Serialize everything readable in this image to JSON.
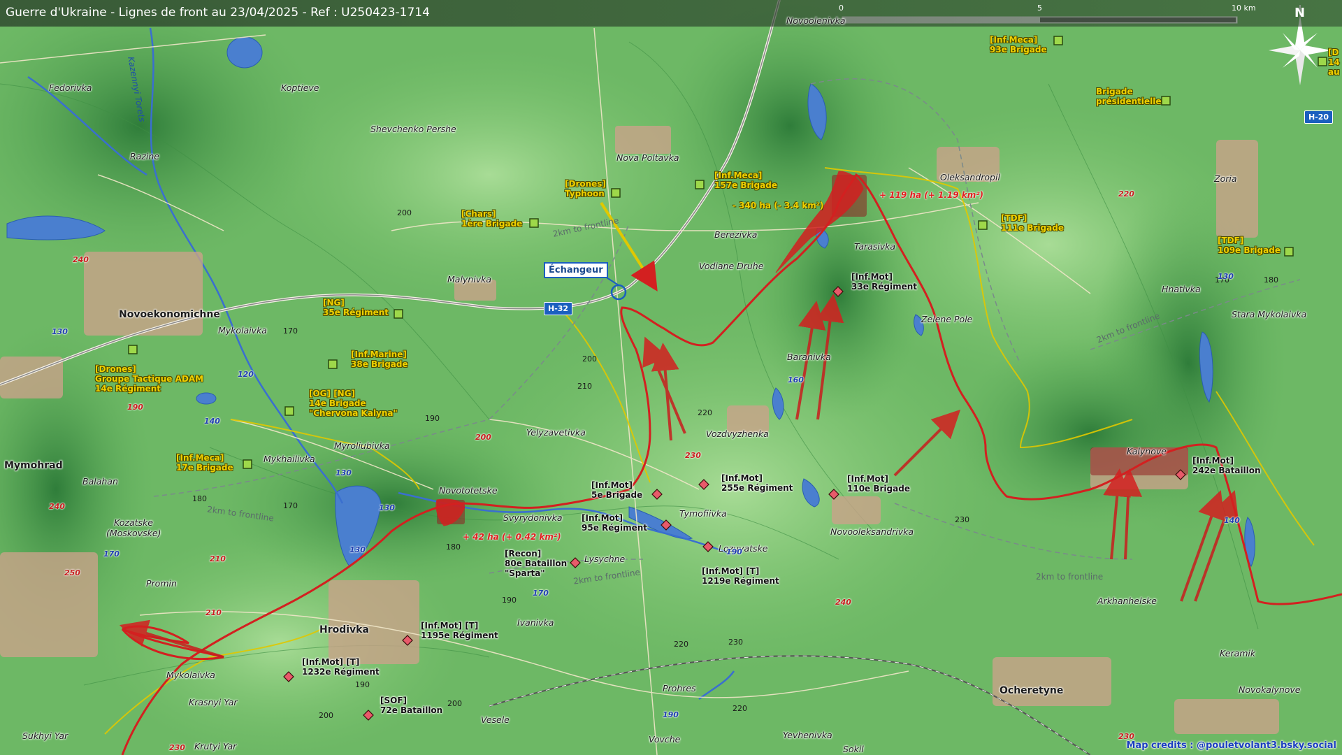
{
  "title": "Guerre d'Ukraine - Lignes de front au 23/04/2025 - Ref : U250423-1714",
  "scale": {
    "labels": [
      "0",
      "5",
      "10 km"
    ]
  },
  "north": "N",
  "colors": {
    "ukrainian_units": "#f0d000",
    "russian_units": "#e05060",
    "frontline": "#d32020",
    "water": "#4a7fcf",
    "road_shield": "#1b5fbf",
    "terrain": "#5fae5a"
  },
  "places": [
    {
      "name": "Fedorivka",
      "big": false
    },
    {
      "name": "Koptieve",
      "big": false
    },
    {
      "name": "Razine",
      "big": false
    },
    {
      "name": "Shevchenko Pershe",
      "big": false
    },
    {
      "name": "Novoolenivka",
      "big": false
    },
    {
      "name": "Nova Poltavka",
      "big": false
    },
    {
      "name": "Berezivka",
      "big": false
    },
    {
      "name": "Tarasivka",
      "big": false
    },
    {
      "name": "Oleksandropil",
      "big": false
    },
    {
      "name": "Zoria",
      "big": false
    },
    {
      "name": "Vodiane Druhe",
      "big": false
    },
    {
      "name": "Malynivka",
      "big": false
    },
    {
      "name": "Zelene Pole",
      "big": false
    },
    {
      "name": "Hnativka",
      "big": false
    },
    {
      "name": "Stara Mykolaivka",
      "big": false
    },
    {
      "name": "Novoekonomichne",
      "big": true
    },
    {
      "name": "Mykolaivka",
      "big": false
    },
    {
      "name": "Baranivka",
      "big": false
    },
    {
      "name": "Vozdvyzhenka",
      "big": false
    },
    {
      "name": "Yelyzavetivka",
      "big": false
    },
    {
      "name": "Myroliubivka",
      "big": false
    },
    {
      "name": "Mykhailivka",
      "big": false
    },
    {
      "name": "Mymohrad",
      "big": true
    },
    {
      "name": "Balahan",
      "big": false
    },
    {
      "name": "Kalynove",
      "big": false
    },
    {
      "name": "Novototetske",
      "big": false
    },
    {
      "name": "Svyrydonivka",
      "big": false
    },
    {
      "name": "Tymofiivka",
      "big": false
    },
    {
      "name": "Novooleksandrivka",
      "big": false
    },
    {
      "name": "Kozatske",
      "big": false
    },
    {
      "name": "(Moskovske)",
      "big": false
    },
    {
      "name": "Lozuvatske",
      "big": false
    },
    {
      "name": "Lysychne",
      "big": false
    },
    {
      "name": "Promin",
      "big": false
    },
    {
      "name": "Arkhanhelske",
      "big": false
    },
    {
      "name": "Ivanivka",
      "big": false
    },
    {
      "name": "Hrodivka",
      "big": true
    },
    {
      "name": "Keramik",
      "big": false
    },
    {
      "name": "Mykolaivka",
      "big": false
    },
    {
      "name": "Ocheretyne",
      "big": true
    },
    {
      "name": "Novokalynove",
      "big": false
    },
    {
      "name": "Prohres",
      "big": false
    },
    {
      "name": "Krasnyi Yar",
      "big": false
    },
    {
      "name": "Vesele",
      "big": false
    },
    {
      "name": "Sukhyi Yar",
      "big": false
    },
    {
      "name": "Krutyi Yar",
      "big": false
    },
    {
      "name": "Vovche",
      "big": false
    },
    {
      "name": "Yevhenivka",
      "big": false
    },
    {
      "name": "Sokil",
      "big": false
    }
  ],
  "rivers": [
    "Kazennyi Torets"
  ],
  "frontline_labels": [
    "2km to frontline",
    "2km to frontline",
    "2km to frontline",
    "2km to frontline",
    "2km to frontline"
  ],
  "altitudes": [
    "200",
    "170",
    "200",
    "210",
    "190",
    "180",
    "170",
    "180",
    "190",
    "220",
    "200",
    "220",
    "230",
    "190",
    "170",
    "180",
    "230",
    "220",
    "200"
  ],
  "road_numbers": [
    {
      "text": "240",
      "color": "red"
    },
    {
      "text": "130",
      "color": "blue"
    },
    {
      "text": "120",
      "color": "blue"
    },
    {
      "text": "190",
      "color": "red"
    },
    {
      "text": "140",
      "color": "blue"
    },
    {
      "text": "200",
      "color": "red"
    },
    {
      "text": "130",
      "color": "blue"
    },
    {
      "text": "240",
      "color": "red"
    },
    {
      "text": "170",
      "color": "blue"
    },
    {
      "text": "210",
      "color": "red"
    },
    {
      "text": "250",
      "color": "red"
    },
    {
      "text": "130",
      "color": "blue"
    },
    {
      "text": "130",
      "color": "blue"
    },
    {
      "text": "210",
      "color": "red"
    },
    {
      "text": "230",
      "color": "red"
    },
    {
      "text": "160",
      "color": "blue"
    },
    {
      "text": "230",
      "color": "red"
    },
    {
      "text": "190",
      "color": "blue"
    },
    {
      "text": "170",
      "color": "blue"
    },
    {
      "text": "240",
      "color": "red"
    },
    {
      "text": "190",
      "color": "blue"
    },
    {
      "text": "220",
      "color": "red"
    },
    {
      "text": "130",
      "color": "blue"
    },
    {
      "text": "140",
      "color": "blue"
    },
    {
      "text": "230",
      "color": "red"
    }
  ],
  "highway_shields": [
    "H-32",
    "H-20"
  ],
  "callout": "Échangeur",
  "area_changes": [
    {
      "text": "- 340 ha (- 3.4 km²)",
      "type": "loss"
    },
    {
      "text": "+ 119 ha (+ 1.19 km²)",
      "type": "gain"
    },
    {
      "text": "+ 42 ha (+ 0.42 km²)",
      "type": "gain"
    }
  ],
  "ua_units": [
    {
      "lines": [
        "[Inf.Meca]",
        "93e Brigade"
      ]
    },
    {
      "lines": [
        "Brigade",
        "présidentielle"
      ]
    },
    {
      "lines": [
        "[Drones]",
        "Typhoon"
      ]
    },
    {
      "lines": [
        "[Inf.Meca]",
        "157e Brigade"
      ]
    },
    {
      "lines": [
        "[Chars]",
        "1ère Brigade"
      ]
    },
    {
      "lines": [
        "[TDF]",
        "111e Brigade"
      ]
    },
    {
      "lines": [
        "[TDF]",
        "109e Brigade"
      ]
    },
    {
      "lines": [
        "[NG]",
        "35e Régiment"
      ]
    },
    {
      "lines": [
        "[Drones]",
        "Groupe Tactique ADAM",
        "14e Régiment"
      ]
    },
    {
      "lines": [
        "[Inf.Marine]",
        "38e Brigade"
      ]
    },
    {
      "lines": [
        "[OG] [NG]",
        "14e Brigade",
        "\"Chervona Kalyna\""
      ]
    },
    {
      "lines": [
        "[Inf.Meca]",
        "17e Brigade"
      ]
    },
    {
      "lines": [
        "[D",
        "14",
        "au"
      ]
    }
  ],
  "ru_units": [
    {
      "lines": [
        "[Inf.Mot]",
        "33e Régiment"
      ]
    },
    {
      "lines": [
        "[Inf.Mot]",
        "5e Brigade"
      ]
    },
    {
      "lines": [
        "[Inf.Mot]",
        "255e Régiment"
      ]
    },
    {
      "lines": [
        "[Inf.Mot]",
        "110e Brigade"
      ]
    },
    {
      "lines": [
        "[Inf.Mot]",
        "95e Régiment"
      ]
    },
    {
      "lines": [
        "[Recon]",
        "80e Bataillon",
        "\"Sparta\""
      ]
    },
    {
      "lines": [
        "[Inf.Mot] [T]",
        "1219e Régiment"
      ]
    },
    {
      "lines": [
        "[Inf.Mot] [T]",
        "1195e Régiment"
      ]
    },
    {
      "lines": [
        "[Inf.Mot] [T]",
        "1232e Régiment"
      ]
    },
    {
      "lines": [
        "[SOF]",
        "72e Bataillon"
      ]
    },
    {
      "lines": [
        "[Inf.Mot]",
        "242e Bataillon"
      ]
    }
  ],
  "credits": "Map credits : @pouletvolant3.bsky.social"
}
